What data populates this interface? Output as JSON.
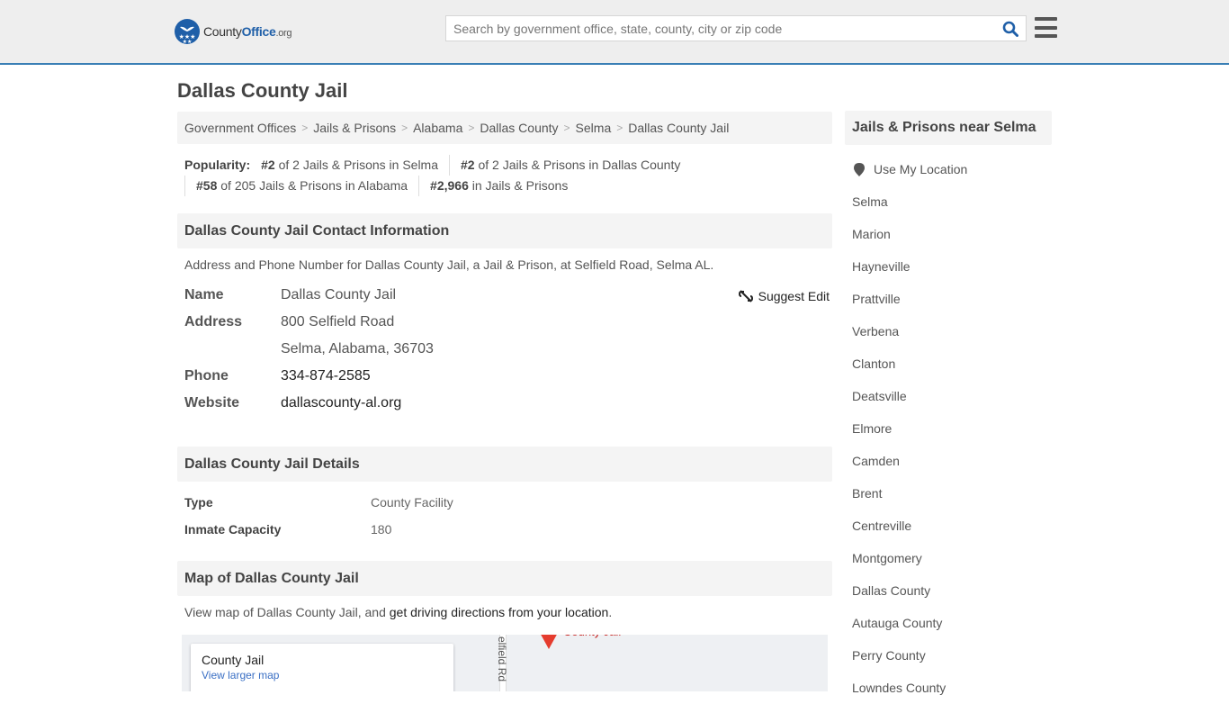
{
  "header": {
    "logo": {
      "county": "County",
      "office": "Office",
      "org": ".org"
    },
    "search_placeholder": "Search by government office, state, county, city or zip code",
    "search_icon": "search-icon",
    "menu_icon": "hamburger-menu-icon"
  },
  "page_title": "Dallas County Jail",
  "breadcrumb": [
    "Government Offices",
    "Jails & Prisons",
    "Alabama",
    "Dallas County",
    "Selma",
    "Dallas County Jail"
  ],
  "popularity": {
    "label": "Popularity:",
    "items": [
      {
        "rank": "#2",
        "text": " of 2 Jails & Prisons in Selma"
      },
      {
        "rank": "#2",
        "text": " of 2 Jails & Prisons in Dallas County"
      },
      {
        "rank": "#58",
        "text": " of 205 Jails & Prisons in Alabama"
      },
      {
        "rank": "#2,966",
        "text": " in Jails & Prisons"
      }
    ]
  },
  "contact": {
    "heading": "Dallas County Jail Contact Information",
    "description": "Address and Phone Number for Dallas County Jail, a Jail & Prison, at Selfield Road, Selma AL.",
    "suggest_edit": "Suggest Edit",
    "rows": {
      "name_label": "Name",
      "name_value": "Dallas County Jail",
      "address_label": "Address",
      "address_line1": "800 Selfield Road",
      "address_line2": "Selma, Alabama, 36703",
      "phone_label": "Phone",
      "phone_value": "334-874-2585",
      "website_label": "Website",
      "website_value": "dallascounty-al.org"
    }
  },
  "details": {
    "heading": "Dallas County Jail Details",
    "rows": [
      {
        "label": "Type",
        "value": "County Facility"
      },
      {
        "label": "Inmate Capacity",
        "value": "180"
      }
    ]
  },
  "map_section": {
    "heading": "Map of Dallas County Jail",
    "desc_prefix": "View map of Dallas County Jail, and ",
    "desc_link": "get driving directions from your location",
    "desc_suffix": ".",
    "card_title": "County Jail",
    "card_link": "View larger map",
    "road_label": "elfield Rd",
    "pin_label": "County Jail"
  },
  "sidebar": {
    "heading": "Jails & Prisons near Selma",
    "use_location": "Use My Location",
    "links": [
      "Selma",
      "Marion",
      "Hayneville",
      "Prattville",
      "Verbena",
      "Clanton",
      "Deatsville",
      "Elmore",
      "Camden",
      "Brent",
      "Centreville",
      "Montgomery",
      "Dallas County",
      "Autauga County",
      "Perry County",
      "Lowndes County"
    ]
  },
  "colors": {
    "brand_blue": "#1f5fa8",
    "header_border": "#3a7fb5",
    "header_bg": "#eeeeee",
    "section_bg": "#f4f4f4",
    "map_pin": "#e53c2e"
  }
}
